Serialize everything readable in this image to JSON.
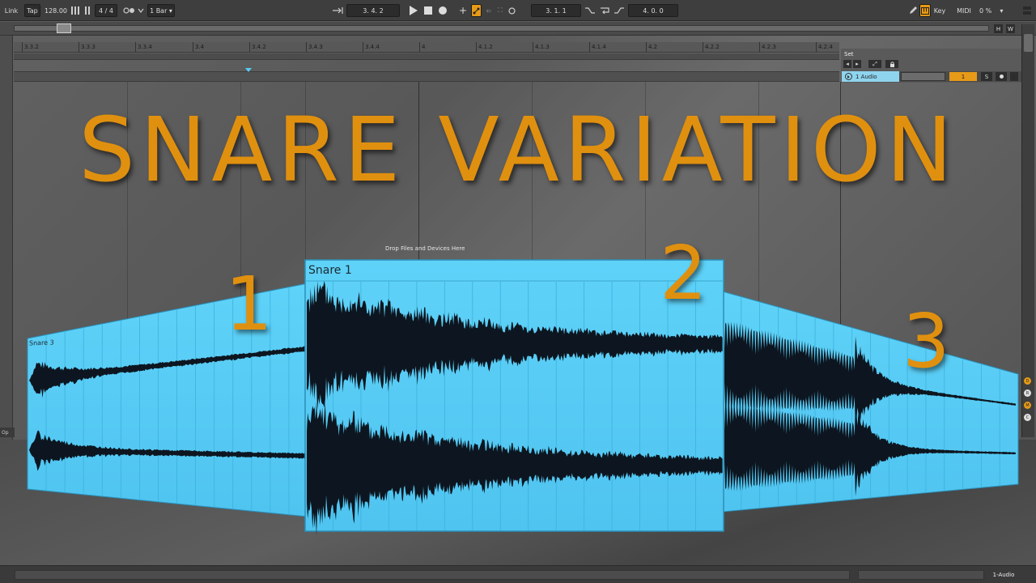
{
  "transport": {
    "link": "Link",
    "tap": "Tap",
    "tempo": "128.00",
    "signature": "4 / 4",
    "quantize": "1 Bar",
    "position": "3.  4.  2",
    "loop_start": "3.  1.  1",
    "loop_length": "4.  0.  0",
    "key": "Key",
    "midi": "MIDI",
    "cpu": "0 %"
  },
  "overview": {
    "h_label": "H",
    "w_label": "W"
  },
  "ruler": {
    "ticks": [
      "3.3.2",
      "3.3.3",
      "3.3.4",
      "3.4",
      "3.4.2",
      "3.4.3",
      "3.4.4",
      "4",
      "4.1.2",
      "4.1.3",
      "4.1.4",
      "4.2",
      "4.2.2",
      "4.2.3",
      "4.2.4"
    ]
  },
  "track_header": {
    "set_label": "Set",
    "track_name": "1 Audio",
    "track_number": "1",
    "solo": "S"
  },
  "drop_hint": "Drop Files and Devices Here",
  "headline": "SNARE VARIATION",
  "variations": {
    "one": "1",
    "two": "2",
    "three": "3",
    "clip_main": "Snare 1",
    "clip_left": "Snare 3"
  },
  "side_buttons": [
    "D",
    "R",
    "M",
    "C"
  ],
  "bottom": {
    "track_label": "1-Audio",
    "left_fragment": "Op"
  },
  "colors": {
    "accent_orange": "#e0900f",
    "clip_blue": "#55ccf5",
    "waveform": "#0d1620",
    "transport_bg": "#3e3e3e"
  }
}
